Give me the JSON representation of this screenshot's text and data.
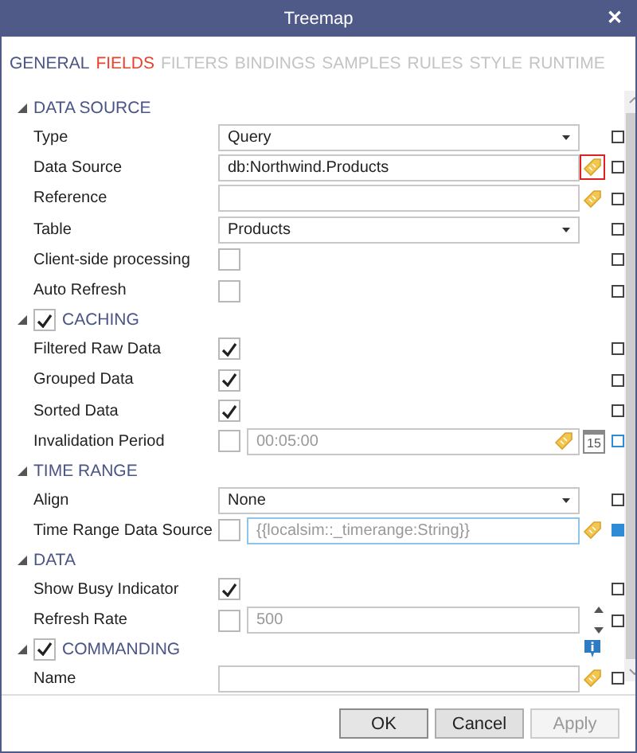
{
  "window": {
    "title": "Treemap",
    "close": "✕"
  },
  "tabs": [
    {
      "label": "GENERAL",
      "selected": true,
      "error": false
    },
    {
      "label": "FIELDS",
      "selected": false,
      "error": true
    },
    {
      "label": "FILTERS",
      "selected": false,
      "error": false
    },
    {
      "label": "BINDINGS",
      "selected": false,
      "error": false
    },
    {
      "label": "SAMPLES",
      "selected": false,
      "error": false
    },
    {
      "label": "RULES",
      "selected": false,
      "error": false
    },
    {
      "label": "STYLE",
      "selected": false,
      "error": false
    },
    {
      "label": "RUNTIME",
      "selected": false,
      "error": false
    }
  ],
  "sections": [
    {
      "title": "DATA SOURCE",
      "expanded": true,
      "rows": [
        {
          "label": "Type",
          "kind": "dropdown",
          "value": "Query",
          "marker_active": false
        },
        {
          "label": "Data Source",
          "kind": "text",
          "value": "db:Northwind.Products",
          "bind": true,
          "bind_highlighted": true,
          "marker_active": false
        },
        {
          "label": "Reference",
          "kind": "text",
          "bind": true,
          "bind_highlighted": false,
          "marker_active": false
        },
        {
          "label": "Table",
          "kind": "dropdown",
          "value": "Products",
          "marker_active": false
        },
        {
          "label": "Client-side processing",
          "kind": "checkbox",
          "checked": false,
          "marker_active": false
        },
        {
          "label": "Auto Refresh",
          "kind": "checkbox",
          "checked": false,
          "marker_active": false
        }
      ]
    },
    {
      "title": "CACHING",
      "expanded": true,
      "checked": true,
      "rows": [
        {
          "label": "Filtered Raw Data",
          "kind": "checkbox",
          "checked": true,
          "marker_active": false
        },
        {
          "label": "Grouped Data",
          "kind": "checkbox",
          "checked": true,
          "marker_active": false
        },
        {
          "label": "Sorted Data",
          "kind": "checkbox",
          "checked": true,
          "marker_active": false
        },
        {
          "label": "Invalidation Period",
          "kind": "checkbox-text",
          "checked": false,
          "value": "00:05:00",
          "disabled": true,
          "bind": true,
          "bind_highlighted": false,
          "calendar": true,
          "calendar_day": "15",
          "marker_active": true,
          "marker_filled": false
        }
      ]
    },
    {
      "title": "TIME RANGE",
      "expanded": true,
      "rows": [
        {
          "label": "Align",
          "kind": "dropdown",
          "value": "None",
          "marker_active": false
        },
        {
          "label": "Time Range Data Source",
          "kind": "checkbox-text",
          "checked": false,
          "value": "{{localsim::_timerange:String}}",
          "disabled": true,
          "focused": true,
          "bind": true,
          "bind_highlighted": false,
          "marker_active": true,
          "marker_filled": true
        }
      ]
    },
    {
      "title": "DATA",
      "expanded": true,
      "rows": [
        {
          "label": "Show Busy Indicator",
          "kind": "checkbox",
          "checked": true,
          "marker_active": false
        },
        {
          "label": "Refresh Rate",
          "kind": "checkbox-text",
          "checked": false,
          "value": "500",
          "disabled": true,
          "stepper": true,
          "marker_active": false
        }
      ]
    },
    {
      "title": "COMMANDING",
      "expanded": true,
      "checked": true,
      "info": true,
      "rows": [
        {
          "label": "Name",
          "kind": "text",
          "bind": true,
          "bind_highlighted": false,
          "marker_active": false
        }
      ]
    }
  ],
  "buttons": [
    {
      "label": "OK",
      "disabled": false,
      "default": true
    },
    {
      "label": "Cancel",
      "disabled": false,
      "default": false
    },
    {
      "label": "Apply",
      "disabled": true,
      "default": false
    }
  ]
}
